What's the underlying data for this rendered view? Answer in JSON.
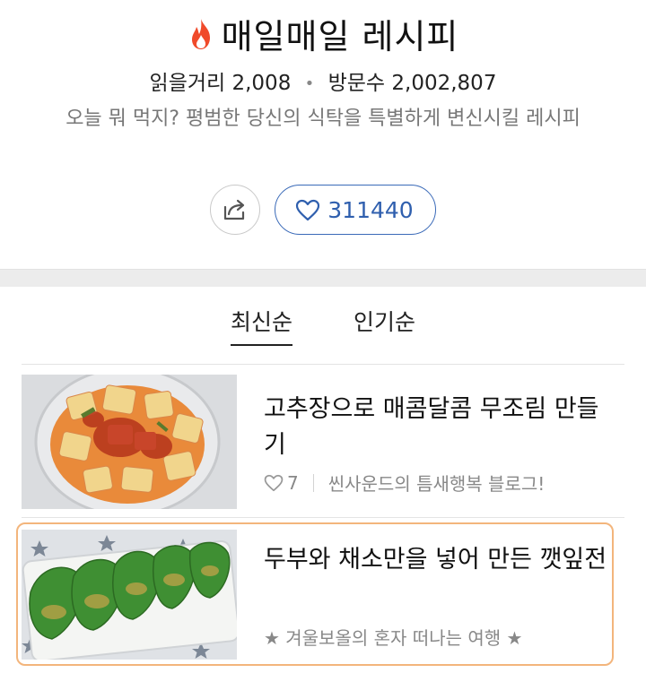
{
  "header": {
    "title": "매일매일 레시피",
    "stats": {
      "posts_label": "읽을거리",
      "posts_count": "2,008",
      "visits_label": "방문수",
      "visits_count": "2,002,807"
    },
    "description": "오늘 뭐 먹지? 평범한 당신의 식탁을 특별하게 변신시킬 레시피",
    "like_count": "311440"
  },
  "tabs": [
    {
      "label": "최신순",
      "active": true
    },
    {
      "label": "인기순",
      "active": false
    }
  ],
  "items": [
    {
      "title": "고추장으로 매콤달콤 무조림 만들기",
      "likes": "7",
      "source": "씬사운드의 틈새행복 블로그!"
    },
    {
      "title": "두부와 채소만을 넣어 만든 깻잎전",
      "source": "★ 겨울보올의 혼자 떠나는 여행 ★"
    }
  ],
  "colors": {
    "accent_blue": "#2f5fae",
    "flame": "#f04a2a",
    "highlight_border": "#f3b57c"
  },
  "icons": [
    "flame-icon",
    "share-icon",
    "heart-outline-icon"
  ]
}
